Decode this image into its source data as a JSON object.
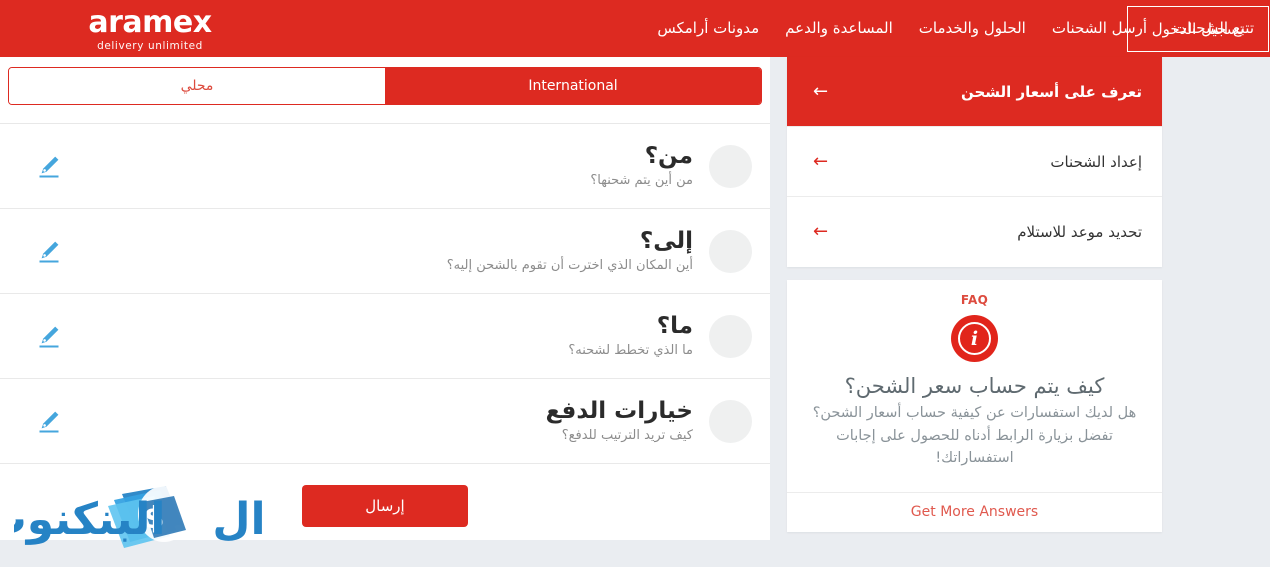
{
  "header": {
    "logo_word": "aramex",
    "logo_tagline": "delivery unlimited",
    "nav_items": [
      {
        "label": "تتبع الشحنات"
      },
      {
        "label": "أرسل الشحنات"
      },
      {
        "label": "الحلول والخدمات"
      },
      {
        "label": "المساعدة والدعم"
      },
      {
        "label": "مدونات أرامكس"
      }
    ],
    "login_label": "تسجيل الدخول",
    "brand_color": "#dd2a21"
  },
  "tabs": [
    {
      "label": "محلي",
      "active": false
    },
    {
      "label": "International",
      "active": true
    }
  ],
  "form": {
    "rows": [
      {
        "title": "من؟",
        "subtitle": "من أين يتم شحنها؟",
        "icon": "pencil-icon"
      },
      {
        "title": "إلى؟",
        "subtitle": "أين المكان الذي اخترت أن تقوم بالشحن إليه؟",
        "icon": "pencil-icon"
      },
      {
        "title": "ما؟",
        "subtitle": "ما الذي تخطط لشحنه؟",
        "icon": "pencil-icon"
      },
      {
        "title": "خيارات الدفع",
        "subtitle": "كيف تريد الترتيب للدفع؟",
        "icon": "pencil-icon"
      }
    ],
    "submit_label": "إرسال"
  },
  "sidebar": {
    "items": [
      {
        "label": "تعرف على أسعار الشحن",
        "active": true,
        "arrow": "arrow-left-icon"
      },
      {
        "label": "إعداد الشحنات",
        "active": false,
        "arrow": "arrow-left-icon"
      },
      {
        "label": "تحديد موعد للاستلام",
        "active": false,
        "arrow": "arrow-left-icon"
      }
    ]
  },
  "faq": {
    "label": "FAQ",
    "icon": "info-icon",
    "question": "كيف يتم حساب سعر الشحن؟",
    "body": "هل لديك استفسارات عن كيفية حساب أسعار الشحن؟ تفضل بزيارة الرابط أدناه للحصول على إجابات استفساراتك!",
    "link_label": "Get More Answers"
  },
  "watermark": {
    "text": "البنكنوت"
  },
  "colors": {
    "brand_red": "#dd2a21",
    "page_bg": "#eaedf1",
    "accent_blue": "#45a6dd",
    "muted_text": "#8a9399"
  }
}
